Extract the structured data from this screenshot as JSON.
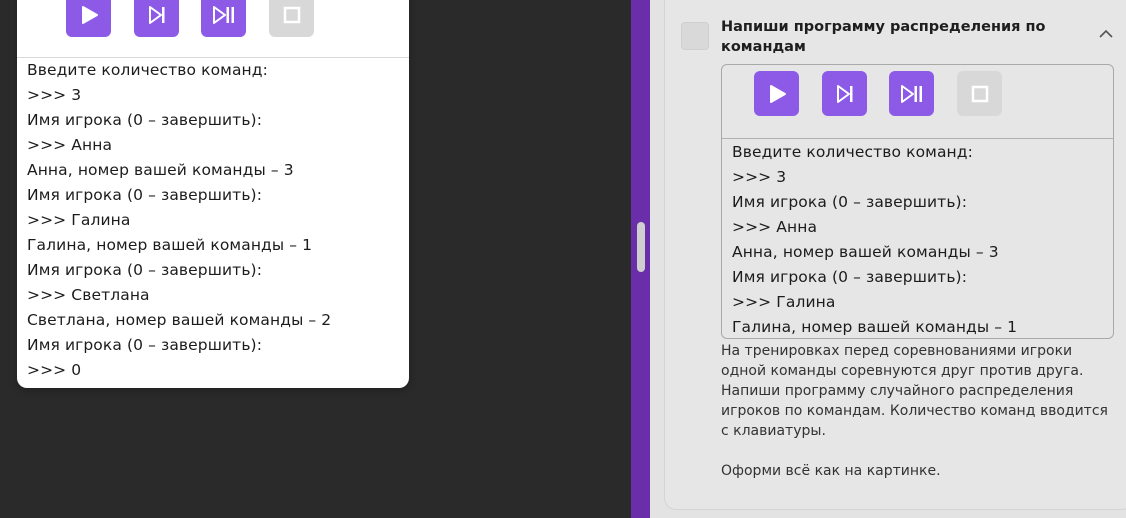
{
  "toolbar": {
    "run_icon": "play-icon",
    "step_icon": "step-icon",
    "step_end_icon": "step-to-end-icon",
    "stop_icon": "stop-icon",
    "accent": "#8c5ae6",
    "disabled": "#d8d8d8"
  },
  "left_console": {
    "lines": [
      "Введите количество команд:",
      ">>> 3",
      "Имя игрока (0 – завершить):",
      ">>> Анна",
      "Анна, номер вашей команды – 3",
      "Имя игрока (0 – завершить):",
      ">>> Галина",
      "Галина, номер вашей команды – 1",
      "Имя игрока (0 – завершить):",
      ">>> Светлана",
      "Светлана, номер вашей команды – 2",
      "Имя игрока (0 – завершить):",
      ">>> 0"
    ]
  },
  "task": {
    "title": "Напиши программу распределения по командам",
    "console_lines": [
      "Введите количество команд:",
      ">>> 3",
      "Имя игрока (0 – завершить):",
      ">>> Анна",
      "Анна, номер вашей команды – 3",
      "Имя игрока (0 – завершить):",
      ">>> Галина",
      "Галина, номер вашей команды – 1"
    ],
    "description_1": "На тренировках перед соревнованиями игроки одной команды соревнуются друг против друга. Напиши программу случайного распределения игроков по командам. Количество команд вводится с клавиатуры.",
    "description_2": "Оформи всё как на картинке."
  }
}
